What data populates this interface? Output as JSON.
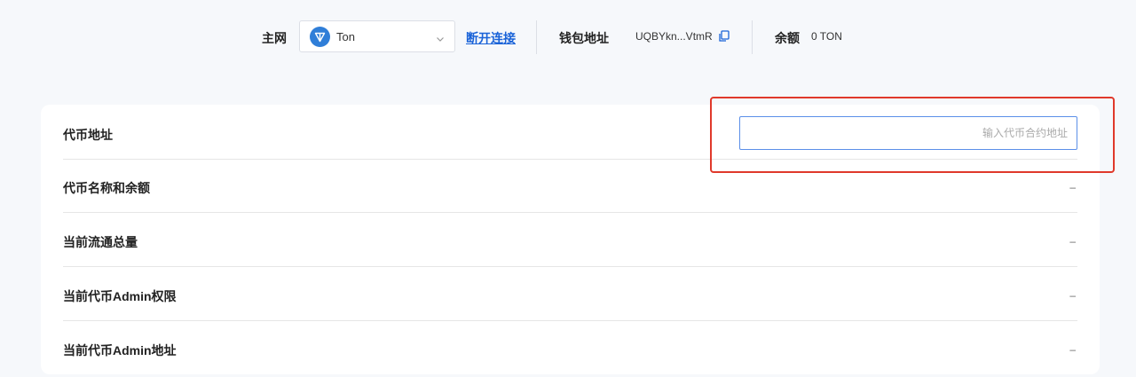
{
  "header": {
    "network_label": "主网",
    "network_value": "Ton",
    "network_icon": "ton-logo-icon",
    "disconnect_label": "断开连接",
    "wallet_label": "钱包地址",
    "wallet_address": "UQBYkn...VtmR",
    "copy_icon": "copy-icon",
    "balance_label": "余额",
    "balance_value": "0 TON"
  },
  "form": {
    "rows": [
      {
        "label": "代币地址",
        "placeholder": "输入代币合约地址",
        "value": ""
      },
      {
        "label": "代币名称和余额",
        "value": "–"
      },
      {
        "label": "当前流通总量",
        "value": "–"
      },
      {
        "label": "当前代币Admin权限",
        "value": "–"
      },
      {
        "label": "当前代币Admin地址",
        "value": "–"
      }
    ]
  },
  "colors": {
    "accent": "#1a63d8",
    "ton_blue": "#2f7ed8",
    "input_border": "#5b8fe8",
    "highlight": "#e0392b",
    "page_bg": "#f6f8fb"
  }
}
